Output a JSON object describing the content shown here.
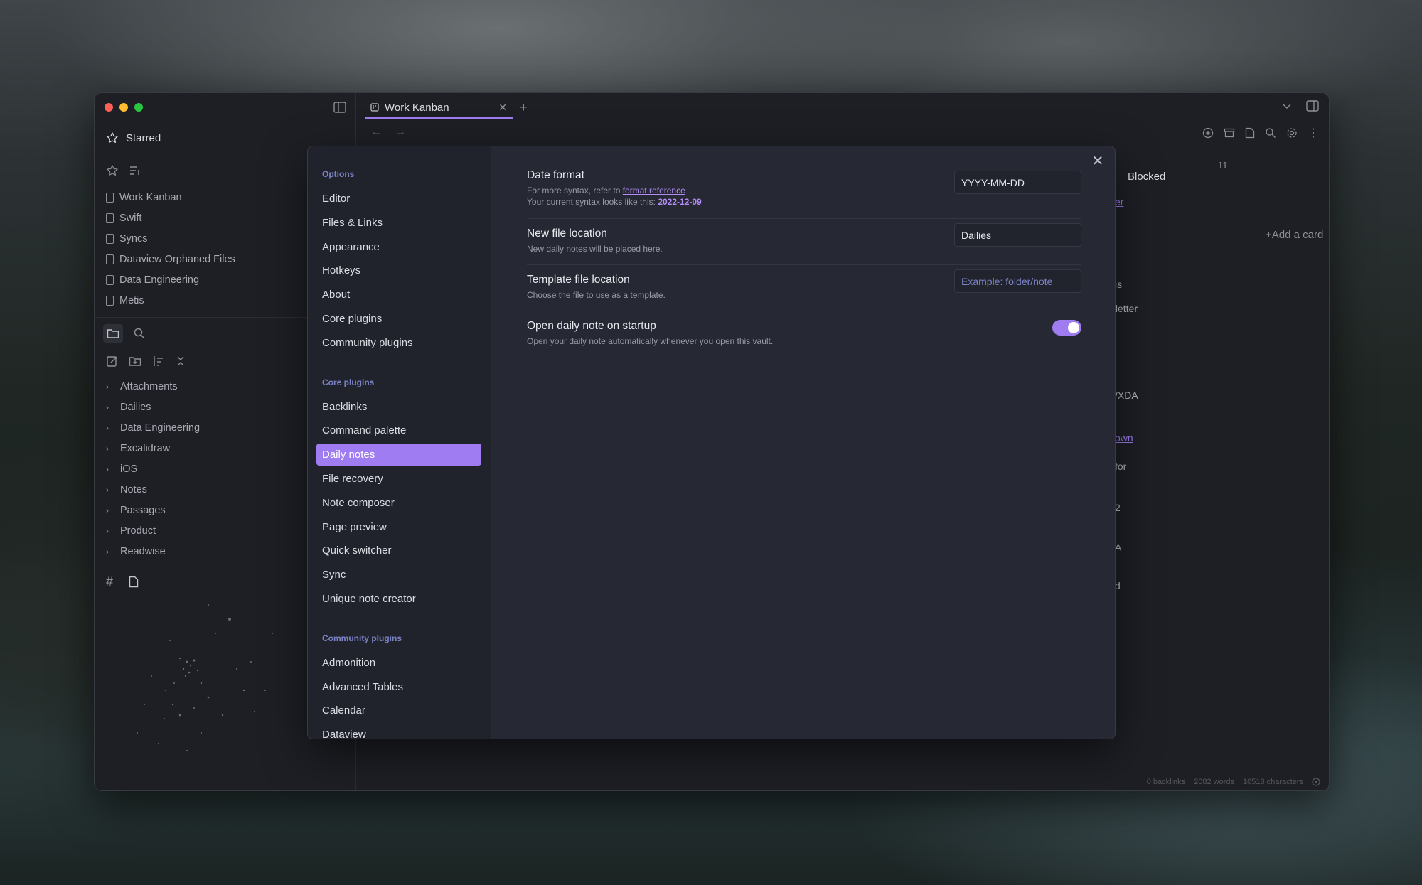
{
  "sidebar": {
    "starred_label": "Starred",
    "starred_items": [
      "Work Kanban",
      "Swift",
      "Syncs",
      "Dataview Orphaned Files",
      "Data Engineering",
      "Metis"
    ],
    "folders": [
      "Attachments",
      "Dailies",
      "Data Engineering",
      "Excalidraw",
      "iOS",
      "Notes",
      "Passages",
      "Product",
      "Readwise"
    ]
  },
  "tabs": {
    "active_title": "Work Kanban"
  },
  "kanban": {
    "count": "11",
    "fragments": [
      "er",
      "is",
      "ewsletter",
      "/XDA",
      "own",
      "for",
      "2",
      "A",
      "d"
    ],
    "blocked_title": "Blocked",
    "add_card": "+Add a card"
  },
  "statusbar": {
    "backlinks": "0 backlinks",
    "words": "2082 words",
    "characters": "10518 characters"
  },
  "settings_nav": {
    "groups": {
      "options": "Options",
      "core_plugins": "Core plugins",
      "community_plugins": "Community plugins"
    },
    "options": [
      "Editor",
      "Files & Links",
      "Appearance",
      "Hotkeys",
      "About",
      "Core plugins",
      "Community plugins"
    ],
    "core_plugins": [
      "Backlinks",
      "Command palette",
      "Daily notes",
      "File recovery",
      "Note composer",
      "Page preview",
      "Quick switcher",
      "Sync",
      "Unique note creator"
    ],
    "community_plugins": [
      "Admonition",
      "Advanced Tables",
      "Calendar",
      "Dataview"
    ]
  },
  "daily_notes": {
    "date_format": {
      "name": "Date format",
      "desc_prefix": "For more syntax, refer to",
      "link": "format reference",
      "current_prefix": "Your current syntax looks like this:",
      "current_value": "2022-12-09",
      "value": "YYYY-MM-DD"
    },
    "new_file_location": {
      "name": "New file location",
      "desc": "New daily notes will be placed here.",
      "value": "Dailies"
    },
    "template_file_location": {
      "name": "Template file location",
      "desc": "Choose the file to use as a template.",
      "placeholder": "Example: folder/note"
    },
    "open_on_startup": {
      "name": "Open daily note on startup",
      "desc": "Open your daily note automatically whenever you open this vault.",
      "enabled": true
    }
  },
  "colors": {
    "accent": "#a07cf2",
    "link": "#b28cf8",
    "group_heading": "#7b83c7"
  },
  "icons": {
    "close": "close-icon",
    "star": "star-icon",
    "folder": "folder-icon",
    "search": "search-icon"
  }
}
